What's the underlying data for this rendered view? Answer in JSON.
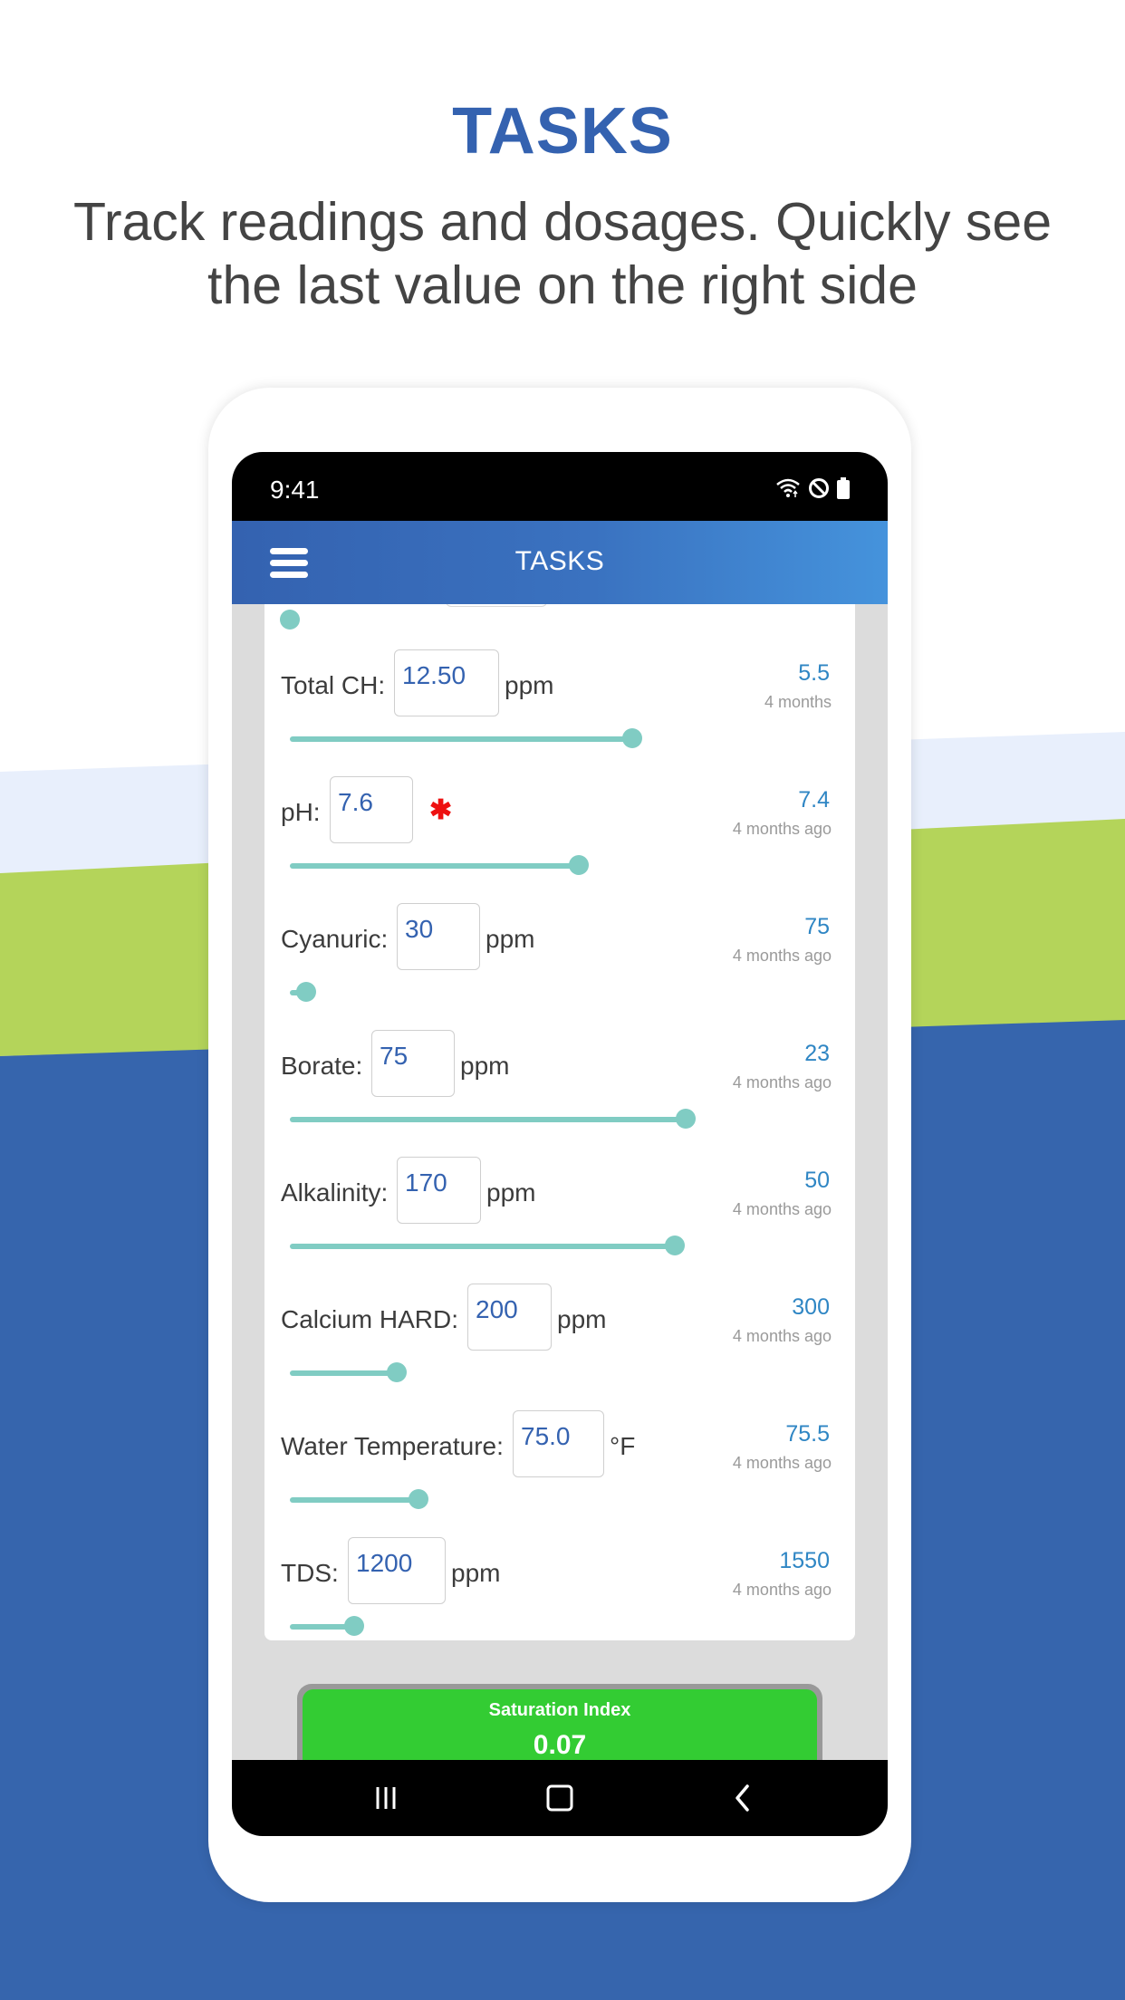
{
  "colors": {
    "brand_blue": "#3462b0",
    "light_band": "#e8effc",
    "green_band": "#b4d45a",
    "teal_slider": "#80ccc3",
    "last_value": "#2f86c4",
    "required_red": "#ee1111",
    "saturation_ok": "#33cc33"
  },
  "hero": {
    "title": "TASKS",
    "subtitle": "Track readings and dosages. Quickly see the last value on the right side"
  },
  "status_bar": {
    "time": "9:41",
    "icons": [
      "wifi-icon",
      "do-not-disturb-icon",
      "battery-icon"
    ]
  },
  "app_bar": {
    "menu_icon": "hamburger-menu-icon",
    "title": "TASKS"
  },
  "partial_row": {
    "slider_fraction": 0.0
  },
  "readings": [
    {
      "label": "Total CH:",
      "value": "12.50",
      "unit": "ppm",
      "required": false,
      "last_value": "5.5",
      "last_when": "4 months",
      "slider_fraction": 0.64
    },
    {
      "label": "pH:",
      "value": "7.6",
      "unit": "",
      "required": true,
      "required_mark": "✱",
      "last_value": "7.4",
      "last_when": "4 months ago",
      "slider_fraction": 0.54
    },
    {
      "label": "Cyanuric:",
      "value": "30",
      "unit": "ppm",
      "required": false,
      "last_value": "75",
      "last_when": "4 months ago",
      "slider_fraction": 0.03
    },
    {
      "label": "Borate:",
      "value": "75",
      "unit": "ppm",
      "required": false,
      "last_value": "23",
      "last_when": "4 months ago",
      "slider_fraction": 0.74
    },
    {
      "label": "Alkalinity:",
      "value": "170",
      "unit": "ppm",
      "required": false,
      "last_value": "50",
      "last_when": "4 months ago",
      "slider_fraction": 0.72
    },
    {
      "label": "Calcium HARD:",
      "value": "200",
      "unit": "ppm",
      "required": false,
      "last_value": "300",
      "last_when": "4 months ago",
      "slider_fraction": 0.2
    },
    {
      "label": "Water Temperature:",
      "value": "75.0",
      "unit": "°F",
      "required": false,
      "last_value": "75.5",
      "last_when": "4 months ago",
      "slider_fraction": 0.24
    },
    {
      "label": "TDS:",
      "value": "1200",
      "unit": "ppm",
      "required": false,
      "last_value": "1550",
      "last_when": "4 months ago",
      "slider_fraction": 0.12
    }
  ],
  "saturation": {
    "title": "Saturation Index",
    "value": "0.07"
  },
  "nav_bar": {
    "recents_icon": "recent-apps-icon",
    "home_icon": "home-icon",
    "back_icon": "back-icon"
  }
}
